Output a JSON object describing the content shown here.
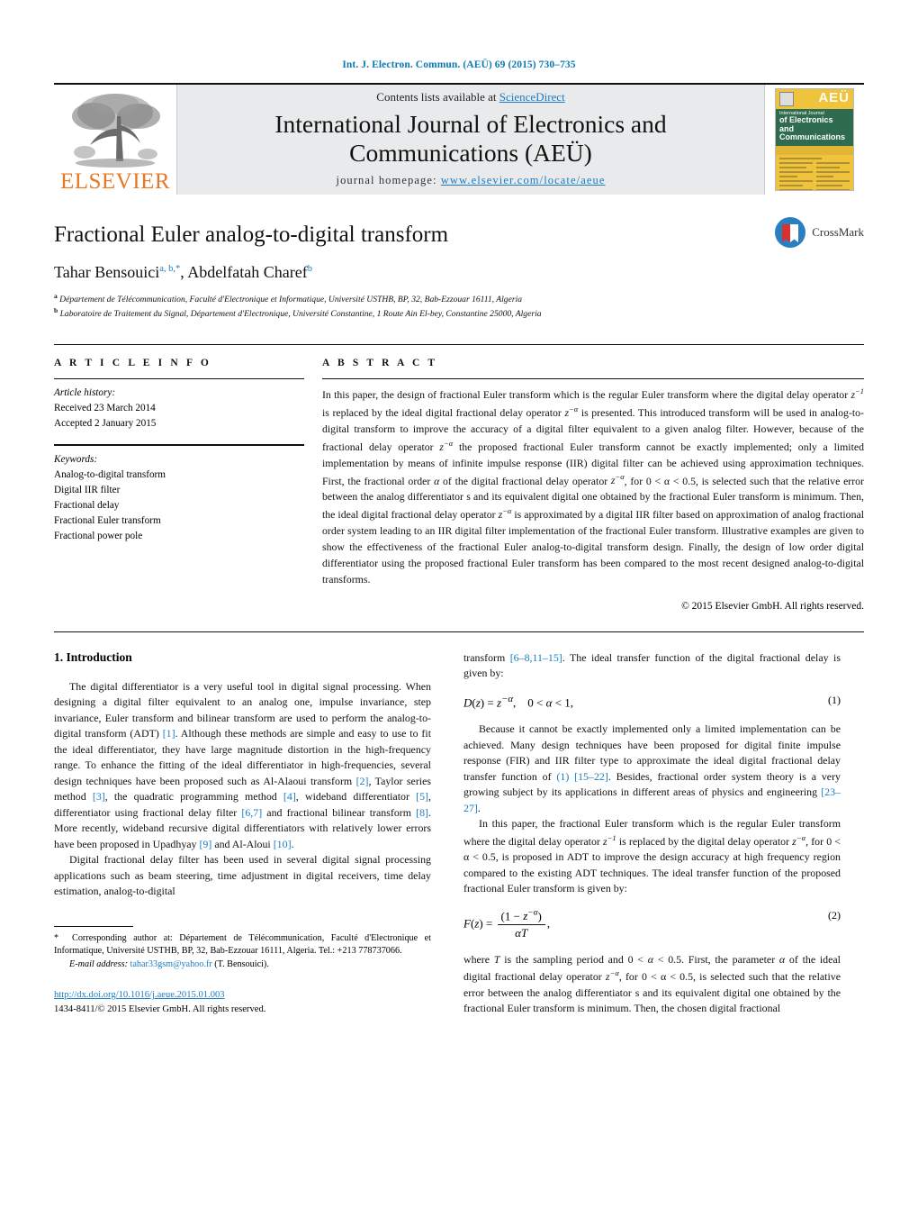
{
  "running_head": "Int. J. Electron. Commun. (AEÜ) 69 (2015) 730–735",
  "masthead": {
    "publisher_name": "ELSEVIER",
    "contents_prefix": "Contents lists available at ",
    "contents_link": "ScienceDirect",
    "journal_title_line1": "International Journal of Electronics and",
    "journal_title_line2": "Communications (AEÜ)",
    "homepage_label": "journal homepage: ",
    "homepage_url": "www.elsevier.com/locate/aeue",
    "cover": {
      "badge": "AEÜ",
      "line1": "International Journal",
      "line2": "of Electronics and",
      "line3": "Communications"
    }
  },
  "article": {
    "title": "Fractional Euler analog-to-digital transform",
    "authors_html": "Tahar Bensouici<sup>a, b,</sup><sup>*</sup>, Abdelfatah Charef<sup>b</sup>",
    "affiliation_a": "Département de Télécommunication, Faculté d'Electronique et Informatique, Université USTHB, BP, 32, Bab-Ezzouar 16111, Algeria",
    "affiliation_b": "Laboratoire de Traitement du Signal, Département d'Electronique, Université Constantine, 1 Route Ain El-bey, Constantine 25000, Algeria",
    "crossmark_label": "CrossMark"
  },
  "info": {
    "heading": "A R T I C L E   I N F O",
    "history_label": "Article history:",
    "received": "Received 23 March 2014",
    "accepted": "Accepted 2 January 2015",
    "keywords_label": "Keywords:",
    "keywords": [
      "Analog-to-digital transform",
      "Digital IIR filter",
      "Fractional delay",
      "Fractional Euler transform",
      "Fractional power pole"
    ]
  },
  "abstract": {
    "heading": "A B S T R A C T",
    "paragraph_html": "In this paper, the design of fractional Euler transform which is the regular Euler transform where the digital delay operator <span class=\"math\">z<sup>−1</sup></span> is replaced by the ideal digital fractional delay operator <span class=\"math\">z<sup>−α</sup></span> is presented. This introduced transform will be used in analog-to-digital transform to improve the accuracy of a digital filter equivalent to a given analog filter. However, because of the fractional delay operator <span class=\"math\">z<sup>−α</sup></span> the proposed fractional Euler transform cannot be exactly implemented; only a limited implementation by means of infinite impulse response (IIR) digital filter can be achieved using approximation techniques. First, the fractional order <span class=\"math\">α</span> of the digital fractional delay operator <span class=\"math\">z<sup>−α</sup></span>, for 0 &lt; α &lt; 0.5, is selected such that the relative error between the analog differentiator s and its equivalent digital one obtained by the fractional Euler transform is minimum. Then, the ideal digital fractional delay operator <span class=\"math\">z<sup>−α</sup></span> is approximated by a digital IIR filter based on approximation of analog fractional order system leading to an IIR digital filter implementation of the fractional Euler transform. Illustrative examples are given to show the effectiveness of the fractional Euler analog-to-digital transform design. Finally, the design of low order digital differentiator using the proposed fractional Euler transform has been compared to the most recent designed analog-to-digital transforms.",
    "copyright": "© 2015 Elsevier GmbH. All rights reserved."
  },
  "body": {
    "section_heading": "1.  Introduction",
    "left_p1_html": "The digital differentiator is a very useful tool in digital signal processing. When designing a digital filter equivalent to an analog one, impulse invariance, step invariance, Euler transform and bilinear transform are used to perform the analog-to-digital transform (ADT) <span class=\"ref\">[1]</span>. Although these methods are simple and easy to use to fit the ideal differentiator, they have large magnitude distortion in the high-frequency range. To enhance the fitting of the ideal differentiator in high-frequencies, several design techniques have been proposed such as Al-Alaoui transform <span class=\"ref\">[2]</span>, Taylor series method <span class=\"ref\">[3]</span>, the quadratic programming method <span class=\"ref\">[4]</span>, wideband differentiator <span class=\"ref\">[5]</span>, differentiator using fractional delay filter <span class=\"ref\">[6,7]</span> and fractional bilinear transform <span class=\"ref\">[8]</span>. More recently, wideband recursive digital differentiators with relatively lower errors have been proposed in Upadhyay <span class=\"ref\">[9]</span> and Al-Aloui <span class=\"ref\">[10]</span>.",
    "left_p2_html": "Digital fractional delay filter has been used in several digital signal processing applications such as beam steering, time adjustment in digital receivers, time delay estimation, analog-to-digital",
    "right_p0_html": "transform <span class=\"ref\">[6–8,11–15]</span>. The ideal transfer function of the digital fractional delay is given by:",
    "eq1_html": "<span class=\"math\">D</span>(<span class=\"math\">z</span>) = <span class=\"math\">z</span><sup><span class=\"math\">−α</span></sup>,&nbsp;&nbsp;&nbsp; 0 &lt; <span class=\"math\">α</span> &lt; 1,",
    "eq1_num": "(1)",
    "right_p1_html": "Because it cannot be exactly implemented only a limited implementation can be achieved. Many design techniques have been proposed for digital finite impulse response (FIR) and IIR filter type to approximate the ideal digital fractional delay transfer function of <span class=\"ref\">(1)</span> <span class=\"ref\">[15–22]</span>. Besides, fractional order system theory is a very growing subject by its applications in different areas of physics and engineering <span class=\"ref\">[23–27]</span>.",
    "right_p2_html": "In this paper, the fractional Euler transform which is the regular Euler transform where the digital delay operator <span class=\"math\">z<sup>−1</sup></span> is replaced by the digital delay operator <span class=\"math\">z<sup>−α</sup></span>, for 0 &lt; α &lt; 0.5, is proposed in ADT to improve the design accuracy at high frequency region compared to the existing ADT techniques. The ideal transfer function of the proposed fractional Euler transform is given by:",
    "eq2_lhs_html": "<span class=\"math\">F</span>(<span class=\"math\">z</span>) = ",
    "eq2_num": "(2)",
    "eq2_numerator": "(1 − z−α)",
    "eq2_denominator": "αT",
    "right_p3_html": "where <span class=\"math\">T</span> is the sampling period and 0 &lt; <span class=\"math\">α</span> &lt; 0.5. First, the parameter <span class=\"math\">α</span> of the ideal digital fractional delay operator <span class=\"math\">z<sup>−α</sup></span>, for 0 &lt; α &lt; 0.5, is selected such that the relative error between the analog differentiator s and its equivalent digital one obtained by the fractional Euler transform is minimum. Then, the chosen digital fractional"
  },
  "footnote": {
    "corresponding_html": "<span class=\"fn-star\">*</span>&nbsp; Corresponding author at: Département de Télécommunication, Faculté d'Electronique et Informatique, Université USTHB, BP, 32, Bab-Ezzouar 16111, Algeria. Tel.: +213 778737066.",
    "email_label": "E-mail address:",
    "email": "tahar33gsm@yahoo.fr",
    "email_suffix": "(T. Bensouici).",
    "doi": "http://dx.doi.org/10.1016/j.aeue.2015.01.003",
    "issn_line": "1434-8411/© 2015 Elsevier GmbH. All rights reserved."
  }
}
